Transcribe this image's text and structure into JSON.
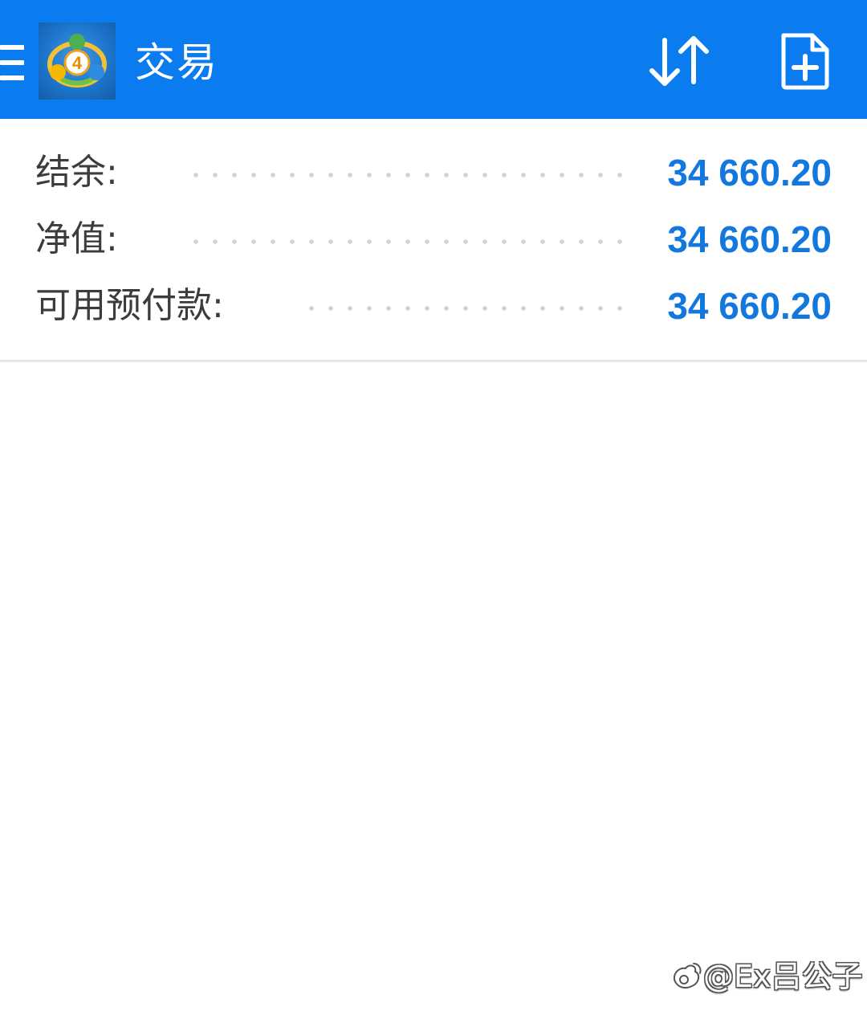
{
  "app_bar": {
    "title": "交易",
    "background": "#0a7cf0",
    "menu_icon": "hamburger-menu-icon",
    "logo_icon": "metatrader-4-logo",
    "logo_badge": "4",
    "sort_icon": "sort-arrows-icon",
    "new_order_icon": "new-order-document-plus-icon"
  },
  "summary": {
    "value_color": "#1378de",
    "rows": [
      {
        "label": "结余:",
        "value": "34 660.20"
      },
      {
        "label": "净值:",
        "value": "34 660.20"
      },
      {
        "label": "可用预付款:",
        "value": "34 660.20"
      }
    ]
  },
  "watermark": {
    "text": "@Ex吕公子",
    "icon": "weibo-icon"
  }
}
